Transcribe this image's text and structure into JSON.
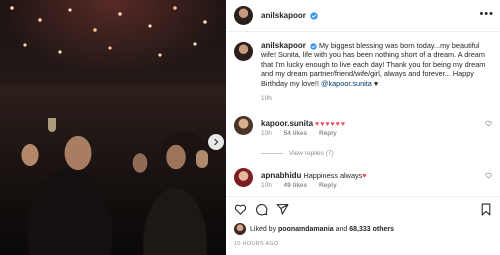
{
  "post": {
    "author": "anilskapoor",
    "verified": true
  },
  "caption": {
    "author": "anilskapoor",
    "text": "My biggest blessing was born today...my beautiful wife! Sunita, life with you has been nothing short of a dream. A dream that I'm lucky enough to live each day! Thank you for being my dream and my dream partner/friend/wife/girl, always and forever... Happy Birthday my love!! ",
    "mention": "@kapoor.sunita",
    "trailing": " ♥",
    "time": "10h"
  },
  "comments": [
    {
      "author": "kapoor.sunita",
      "text": "♥♥♥♥♥♥",
      "time": "10h",
      "likes": "54 likes",
      "reply": "Reply"
    },
    {
      "author": "apnabhidu",
      "text": "Happiness always",
      "time": "10h",
      "likes": "49 likes",
      "reply": "Reply"
    }
  ],
  "view_replies": "View replies (7)",
  "liked_by": {
    "prefix": "Liked by ",
    "user": "poonamdamania",
    "middle": " and ",
    "count": "68,333 others"
  },
  "posted_time": "10 HOURS AGO",
  "colors": {
    "verified": "#3897f0",
    "heart": "#ed4956",
    "mention": "#00376b"
  },
  "icons": [
    "heart-icon",
    "comment-icon",
    "share-icon",
    "bookmark-icon",
    "more-icon",
    "chevron-right-icon"
  ]
}
